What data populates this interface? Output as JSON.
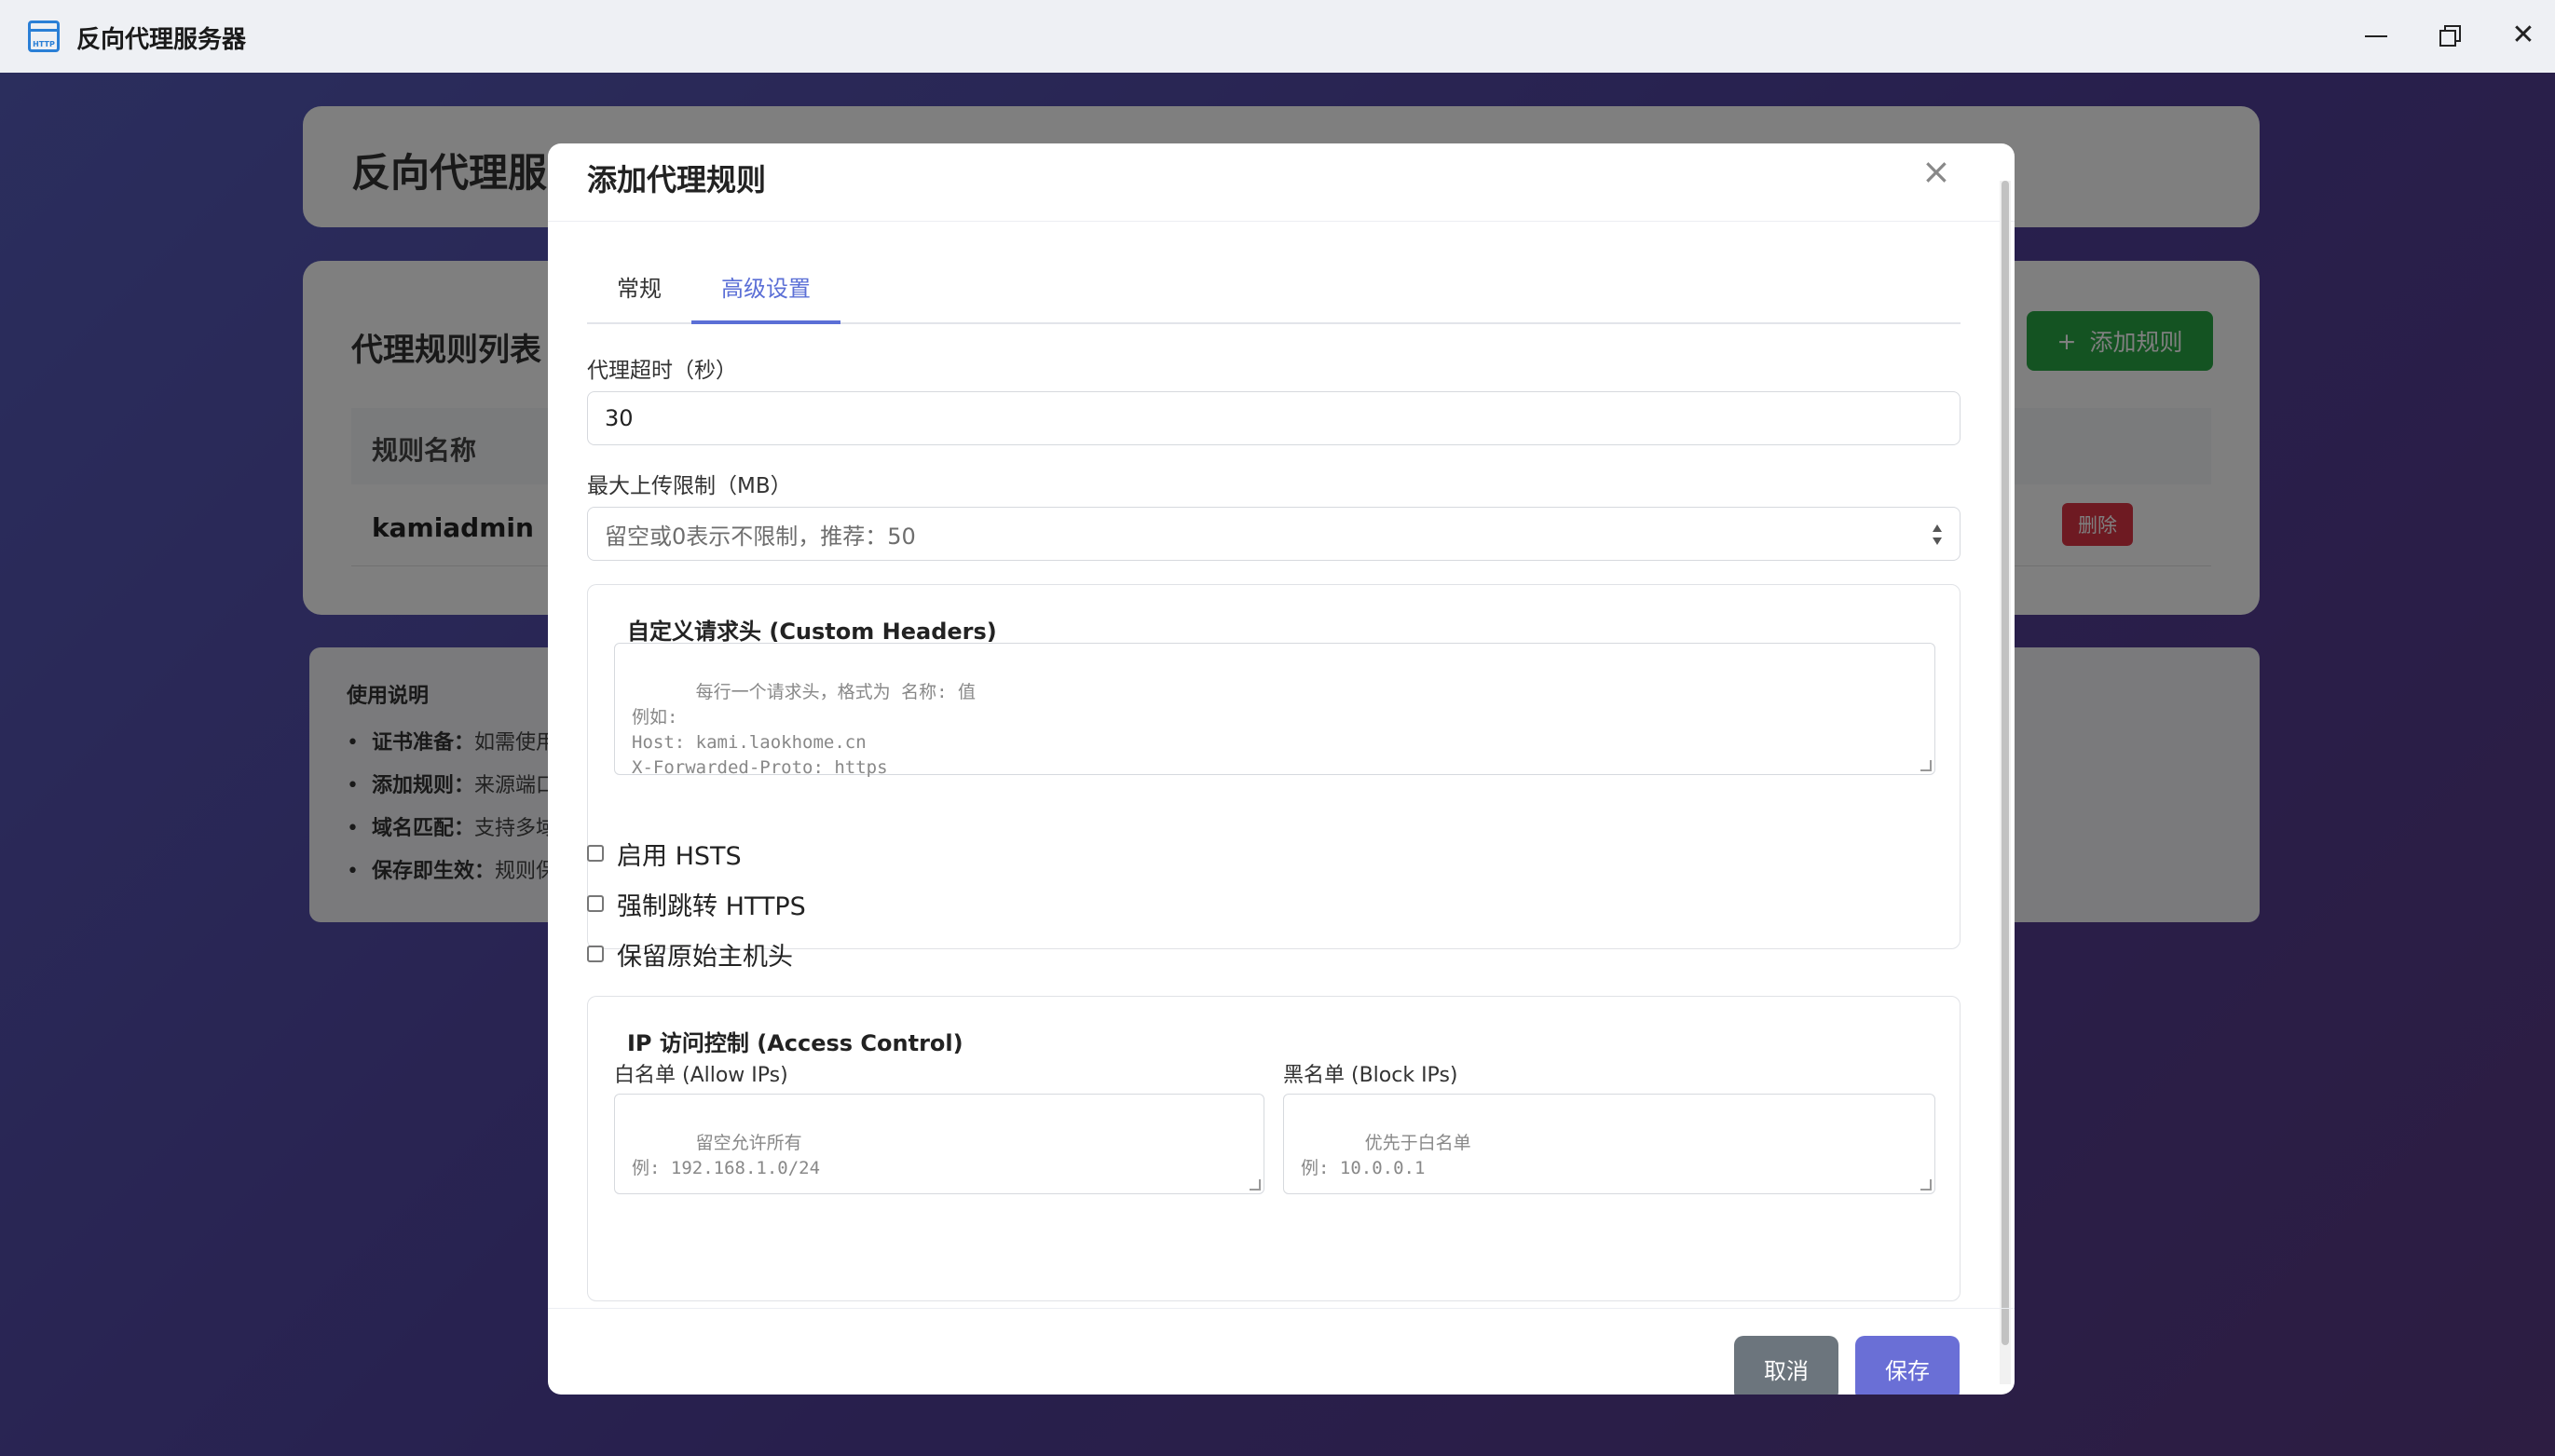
{
  "window": {
    "title": "反向代理服务器",
    "icon_label": "HTTP"
  },
  "background": {
    "header_title": "反向代理服务器",
    "rules_title": "代理规则列表",
    "add_rule_label": "添加规则",
    "add_rule_icon": "+",
    "table_header": "规则名称",
    "row_name": "kamiadmin",
    "delete_label": "删除",
    "usage_title": "使用说明",
    "usage_items": [
      {
        "key": "证书准备：",
        "text": "如需使用"
      },
      {
        "key": "添加规则：",
        "text": "来源端口"
      },
      {
        "key": "域名匹配：",
        "text": "支持多域"
      },
      {
        "key": "保存即生效：",
        "text": "规则保"
      }
    ]
  },
  "modal": {
    "title": "添加代理规则",
    "close_glyph": "×",
    "tabs": [
      {
        "label": "常规",
        "active": false
      },
      {
        "label": "高级设置",
        "active": true
      }
    ],
    "timeout": {
      "label": "代理超时（秒）",
      "value": "30"
    },
    "upload": {
      "label": "最大上传限制（MB）",
      "placeholder": "留空或0表示不限制，推荐：50"
    },
    "headers": {
      "legend": "自定义请求头 (Custom Headers)",
      "placeholder": "每行一个请求头，格式为 名称: 值\n例如:\nHost: kami.laokhome.cn\nX-Forwarded-Proto: https"
    },
    "checkboxes": [
      {
        "label": "启用 HSTS",
        "checked": false
      },
      {
        "label": "强制跳转 HTTPS",
        "checked": false
      },
      {
        "label": "保留原始主机头",
        "checked": false
      }
    ],
    "access": {
      "legend": "IP 访问控制 (Access Control)",
      "allow_label": "白名单 (Allow IPs)",
      "allow_placeholder": "留空允许所有\n例: 192.168.1.0/24",
      "block_label": "黑名单 (Block IPs)",
      "block_placeholder": "优先于白名单\n例: 10.0.0.1"
    },
    "cancel_label": "取消",
    "save_label": "保存"
  },
  "colors": {
    "accent": "#5b6fd6",
    "success": "#28a745",
    "danger": "#dc3545",
    "secondary": "#6c757d"
  }
}
